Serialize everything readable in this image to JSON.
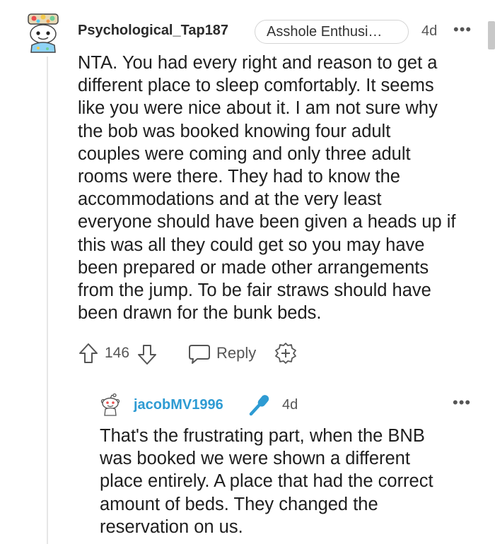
{
  "comment": {
    "username": "Psychological_Tap187",
    "flair": "Asshole Enthusi…",
    "age": "4d",
    "more": "•••",
    "body": "NTA. You had every right and reason to get a\ndifferent place to sleep comfortably. It seems\nlike you were nice about it. I am not sure why\nthe bob was booked knowing four adult\ncouples were coming and only three adult\nrooms were there. They had to know the\naccommodations and at the very least\neveryone should have been given a heads up if\nthis was all they could get so you may have\nbeen prepared or made other arrangements\nfrom the jump. To be fair straws should have\nbeen drawn for the bunk beds.",
    "votes": "146",
    "reply_label": "Reply",
    "icons": {
      "avatar": "snoo-avatar-with-flower-hat",
      "upvote": "arrow-up-icon",
      "downvote": "arrow-down-icon",
      "reply": "speech-bubble-icon",
      "award": "award-plus-icon"
    }
  },
  "reply": {
    "username": "jacobMV1996",
    "age": "4d",
    "more": "•••",
    "body": "That's the frustrating part, when the BNB\nwas booked we were shown a different\nplace entirely. A place that had the correct\namount of beds. They changed the\nreservation on us.",
    "icons": {
      "avatar": "snoo-avatar",
      "badge": "microphone-icon"
    }
  },
  "colors": {
    "username_reply": "#2e9bd3",
    "mic": "#2e9bd3",
    "text": "#1e1e1e",
    "muted": "#555555",
    "thread_line": "#e6e6e6"
  }
}
